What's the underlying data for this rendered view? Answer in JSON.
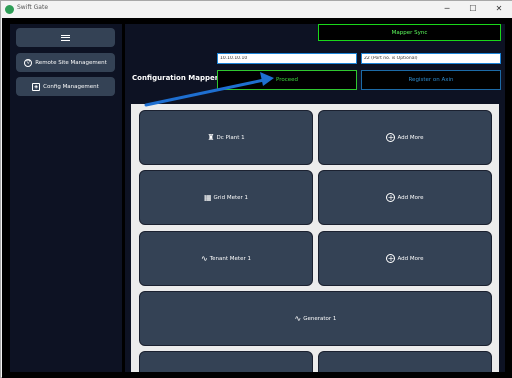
{
  "window": {
    "title": "Swift Gate",
    "minimize": "─",
    "maximize": "☐",
    "close": "✕"
  },
  "sidebar": {
    "menu_icon": "hamburger-icon",
    "items": [
      {
        "label": "Remote Site Management",
        "icon": "sitemap-icon"
      },
      {
        "label": "Config Management",
        "icon": "cube-icon"
      }
    ]
  },
  "header": {
    "mapper_sync_label": "Mapper Sync",
    "section_title": "Configuration Mapper",
    "ip_value": "10.10.10.10",
    "port_value": "22 (Port no. is Optional)",
    "proceed_label": "Proceed",
    "register_label": "Register on Axin"
  },
  "cards": [
    {
      "label": "Dc Plant 1",
      "icon": "tower-icon",
      "glyph": "♜"
    },
    {
      "label": "Add More",
      "icon": "plus-circle-icon",
      "glyph": "+"
    },
    {
      "label": "Grid Meter 1",
      "icon": "grid-icon",
      "glyph": "▦"
    },
    {
      "label": "Add More",
      "icon": "plus-circle-icon",
      "glyph": "+"
    },
    {
      "label": "Tenant Meter 1",
      "icon": "pulse-icon",
      "glyph": "∿"
    },
    {
      "label": "Add More",
      "icon": "plus-circle-icon",
      "glyph": "+"
    },
    {
      "label": "Generator 1",
      "icon": "pulse-icon",
      "glyph": "∿"
    }
  ],
  "colors": {
    "sidebar_bg": "#0d1223",
    "card_bg": "#344255",
    "proceed_green": "#2fc72f",
    "register_blue": "#1c6aa6",
    "annotation_arrow": "#1e6fd1"
  }
}
